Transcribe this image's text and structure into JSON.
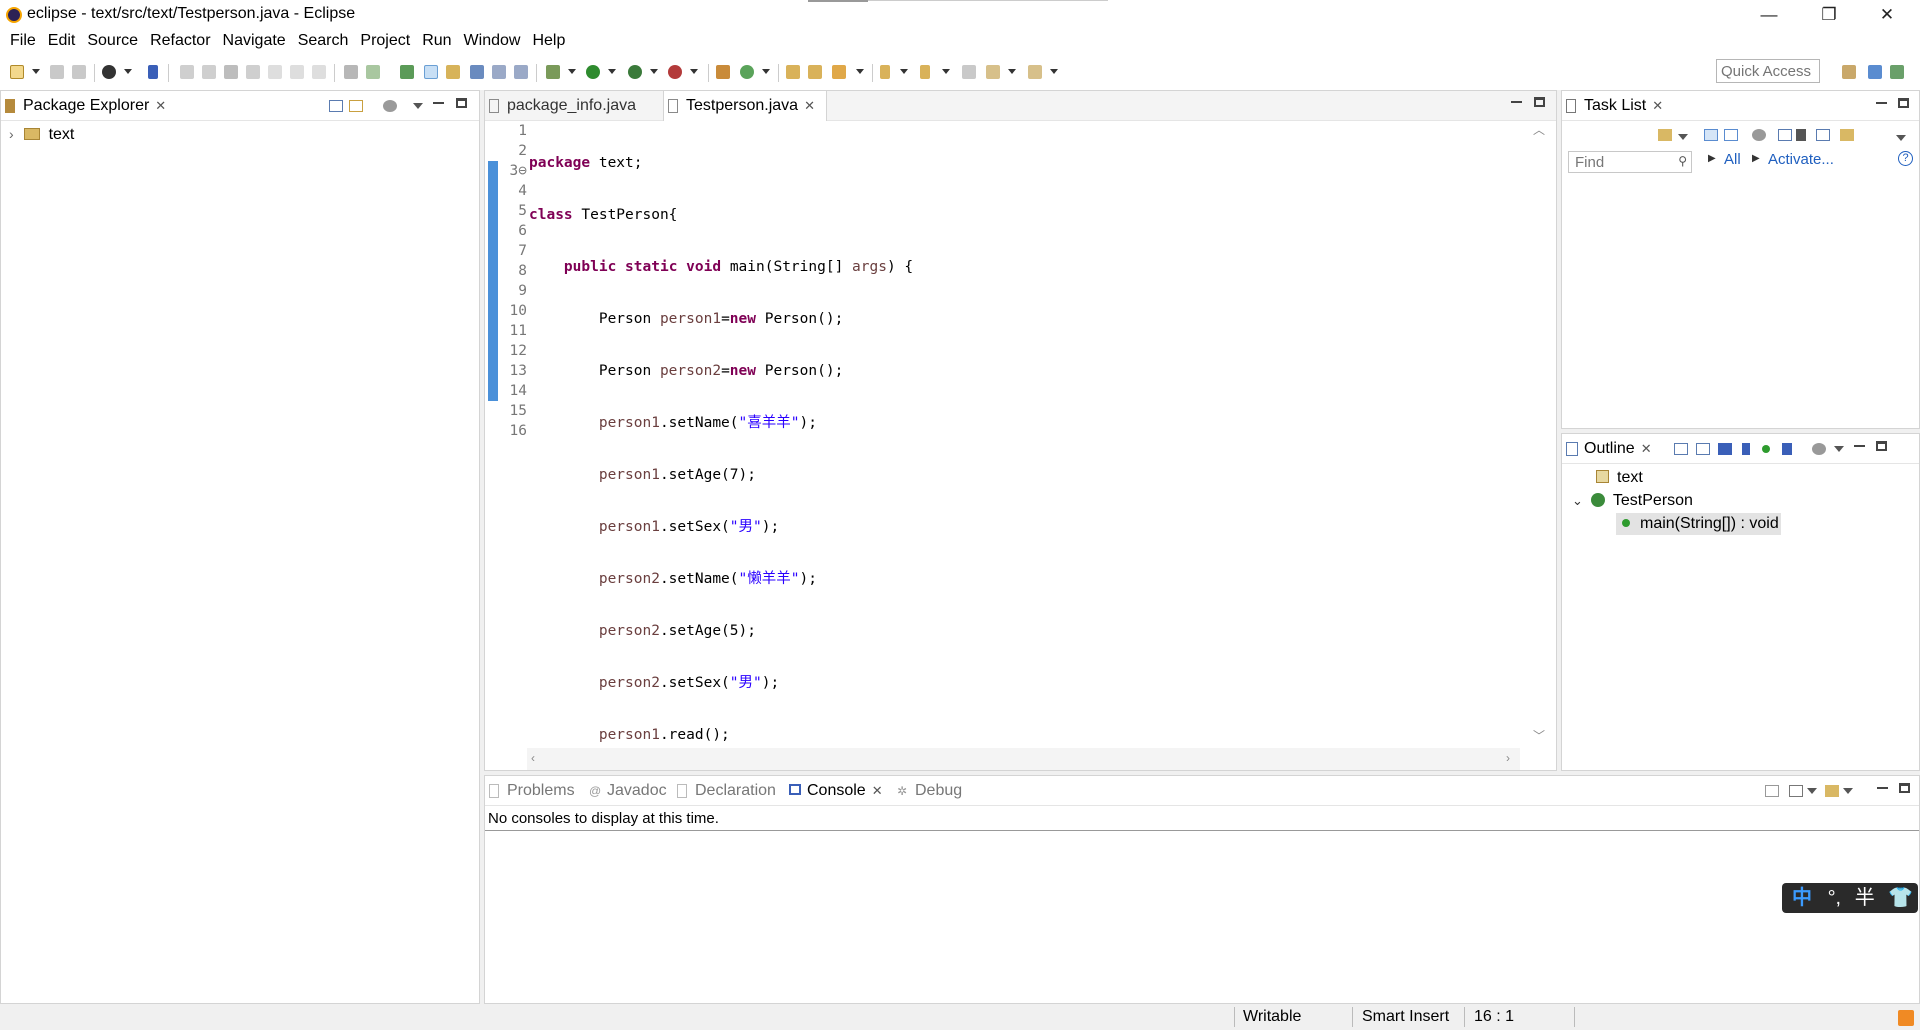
{
  "window": {
    "title": "eclipse - text/src/text/Testperson.java - Eclipse",
    "minimize": "—",
    "restore": "❐",
    "close": "✕"
  },
  "menu": [
    "File",
    "Edit",
    "Source",
    "Refactor",
    "Navigate",
    "Search",
    "Project",
    "Run",
    "Window",
    "Help"
  ],
  "toolbar": {
    "quick_access": "Quick Access"
  },
  "package_explorer": {
    "tab_label": "Package Explorer",
    "tree": [
      {
        "expander": "›",
        "label": "text"
      }
    ]
  },
  "editor": {
    "tabs": [
      {
        "label": "package_info.java",
        "active": false
      },
      {
        "label": "Testperson.java",
        "active": true
      }
    ],
    "line_numbers": [
      "1",
      "2",
      "3⊖",
      "4",
      "5",
      "6",
      "7",
      "8",
      "9",
      "10",
      "11",
      "12",
      "13",
      "14",
      "15",
      "16"
    ],
    "current_line": 16
  },
  "task_list": {
    "tab_label": "Task List",
    "find_placeholder": "Find",
    "all_label": "All",
    "activate_label": "Activate...",
    "help": "?"
  },
  "outline": {
    "tab_label": "Outline",
    "items": [
      {
        "label": "text",
        "kind": "package"
      },
      {
        "label": "TestPerson",
        "kind": "class",
        "expander": "⌄"
      },
      {
        "label": "main(String[]) : void",
        "kind": "method",
        "selected": true
      }
    ]
  },
  "console": {
    "tabs": [
      {
        "label": "Problems",
        "active": false
      },
      {
        "label": "Javadoc",
        "active": false
      },
      {
        "label": "Declaration",
        "active": false
      },
      {
        "label": "Console",
        "active": true
      },
      {
        "label": "Debug",
        "active": false
      }
    ],
    "message": "No consoles to display at this time."
  },
  "status": {
    "writable": "Writable",
    "insert_mode": "Smart Insert",
    "position": "16 : 1"
  },
  "ime": {
    "mode": "中",
    "punct": "°,",
    "width": "半"
  },
  "colors": {
    "keyword": "#7f0055",
    "string": "#2a00ff",
    "local_var": "#6a3e3e",
    "current_line": "#e8f2fe",
    "ruler_mark": "#4a90d9",
    "selection": "#e3e3e3"
  }
}
